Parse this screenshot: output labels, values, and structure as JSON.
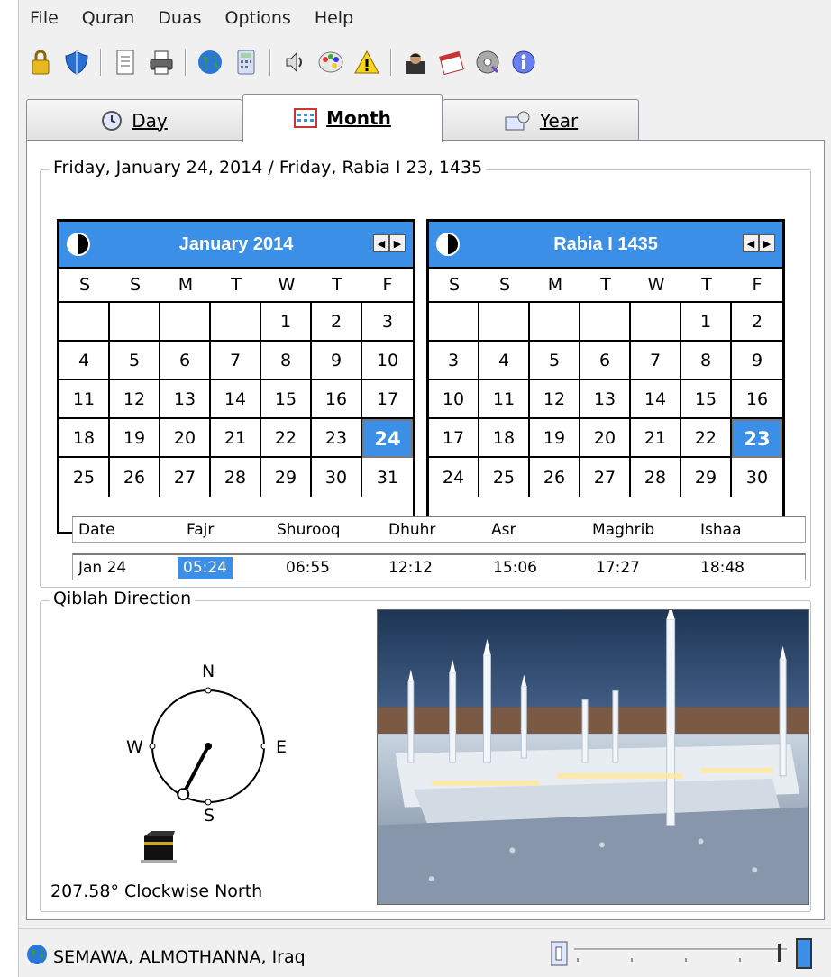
{
  "menu": [
    "File",
    "Quran",
    "Duas",
    "Options",
    "Help"
  ],
  "toolbar_icons": [
    "lock-icon",
    "shield-icon",
    "notes-icon",
    "printer-icon",
    "globe-icon",
    "calculator-icon",
    "speaker-icon",
    "palette-icon",
    "warning-icon",
    "imam-icon",
    "calendar-icon",
    "cd-icon",
    "info-icon"
  ],
  "tabs": [
    {
      "label": "Day",
      "icon": "clock-icon"
    },
    {
      "label": "Month",
      "icon": "month-calendar-icon"
    },
    {
      "label": "Year",
      "icon": "year-icon"
    }
  ],
  "date_header": "Friday, January 24, 2014 / Friday, Rabia I 23, 1435",
  "gregorian": {
    "title": "January 2014",
    "dow": [
      "S",
      "S",
      "M",
      "T",
      "W",
      "T",
      "F"
    ],
    "days": [
      "",
      "",
      "",
      "",
      "1",
      "2",
      "3",
      "4",
      "5",
      "6",
      "7",
      "8",
      "9",
      "10",
      "11",
      "12",
      "13",
      "14",
      "15",
      "16",
      "17",
      "18",
      "19",
      "20",
      "21",
      "22",
      "23",
      "24",
      "25",
      "26",
      "27",
      "28",
      "29",
      "30",
      "31"
    ],
    "selected": "24"
  },
  "hijri": {
    "title": "Rabia I 1435",
    "dow": [
      "S",
      "S",
      "M",
      "T",
      "W",
      "T",
      "F"
    ],
    "days": [
      "",
      "",
      "",
      "",
      "",
      "1",
      "2",
      "3",
      "4",
      "5",
      "6",
      "7",
      "8",
      "9",
      "10",
      "11",
      "12",
      "13",
      "14",
      "15",
      "16",
      "17",
      "18",
      "19",
      "20",
      "21",
      "22",
      "23",
      "24",
      "25",
      "26",
      "27",
      "28",
      "29",
      "30"
    ],
    "selected": "23"
  },
  "prayer_times": {
    "headers": [
      "Date",
      "Fajr",
      "Shurooq",
      "Dhuhr",
      "Asr",
      "Maghrib",
      "Ishaa"
    ],
    "values": [
      "Jan 24",
      "05:24",
      "06:55",
      "12:12",
      "15:06",
      "17:27",
      "18:48"
    ],
    "highlight": "Fajr"
  },
  "qiblah": {
    "legend": "Qiblah Direction",
    "n": "N",
    "s": "S",
    "e": "E",
    "w": "W",
    "direction_text": "207.58° Clockwise North",
    "angle_deg": 207.58
  },
  "status": {
    "location": "SEMAWA, ALMOTHANNA, Iraq"
  },
  "colors": {
    "accent": "#3c8fe6"
  }
}
